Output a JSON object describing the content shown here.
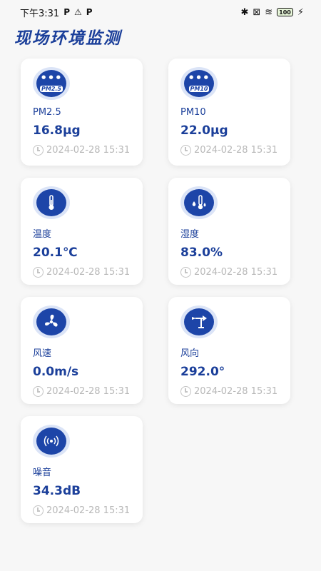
{
  "status_bar": {
    "time": "下午3:31",
    "left_glyphs": [
      "P",
      "⚠",
      "P"
    ],
    "battery": "100",
    "right_glyphs": [
      "✱",
      "⊠",
      "≋",
      "⚡"
    ]
  },
  "page": {
    "title": "现场环境监测"
  },
  "colors": {
    "accent": "#1b3f9a",
    "icon_bg": "#1d45a8",
    "icon_ring": "#dbe4f7",
    "timestamp": "#b8b8b8"
  },
  "cards": [
    {
      "icon": "pm25-icon",
      "icon_text": "PM2.5",
      "label": "PM2.5",
      "value": "16.8μg",
      "time": "2024-02-28 15:31"
    },
    {
      "icon": "pm10-icon",
      "icon_text": "PM10",
      "label": "PM10",
      "value": "22.0μg",
      "time": "2024-02-28 15:31"
    },
    {
      "icon": "thermometer-icon",
      "icon_text": "",
      "label": "温度",
      "value": "20.1℃",
      "time": "2024-02-28 15:31"
    },
    {
      "icon": "humidity-icon",
      "icon_text": "",
      "label": "湿度",
      "value": "83.0%",
      "time": "2024-02-28 15:31"
    },
    {
      "icon": "fan-icon",
      "icon_text": "",
      "label": "风速",
      "value": "0.0m/s",
      "time": "2024-02-28 15:31"
    },
    {
      "icon": "wind-vane-icon",
      "icon_text": "",
      "label": "风向",
      "value": "292.0°",
      "time": "2024-02-28 15:31"
    },
    {
      "icon": "noise-icon",
      "icon_text": "",
      "label": "噪音",
      "value": "34.3dB",
      "time": "2024-02-28 15:31"
    }
  ]
}
